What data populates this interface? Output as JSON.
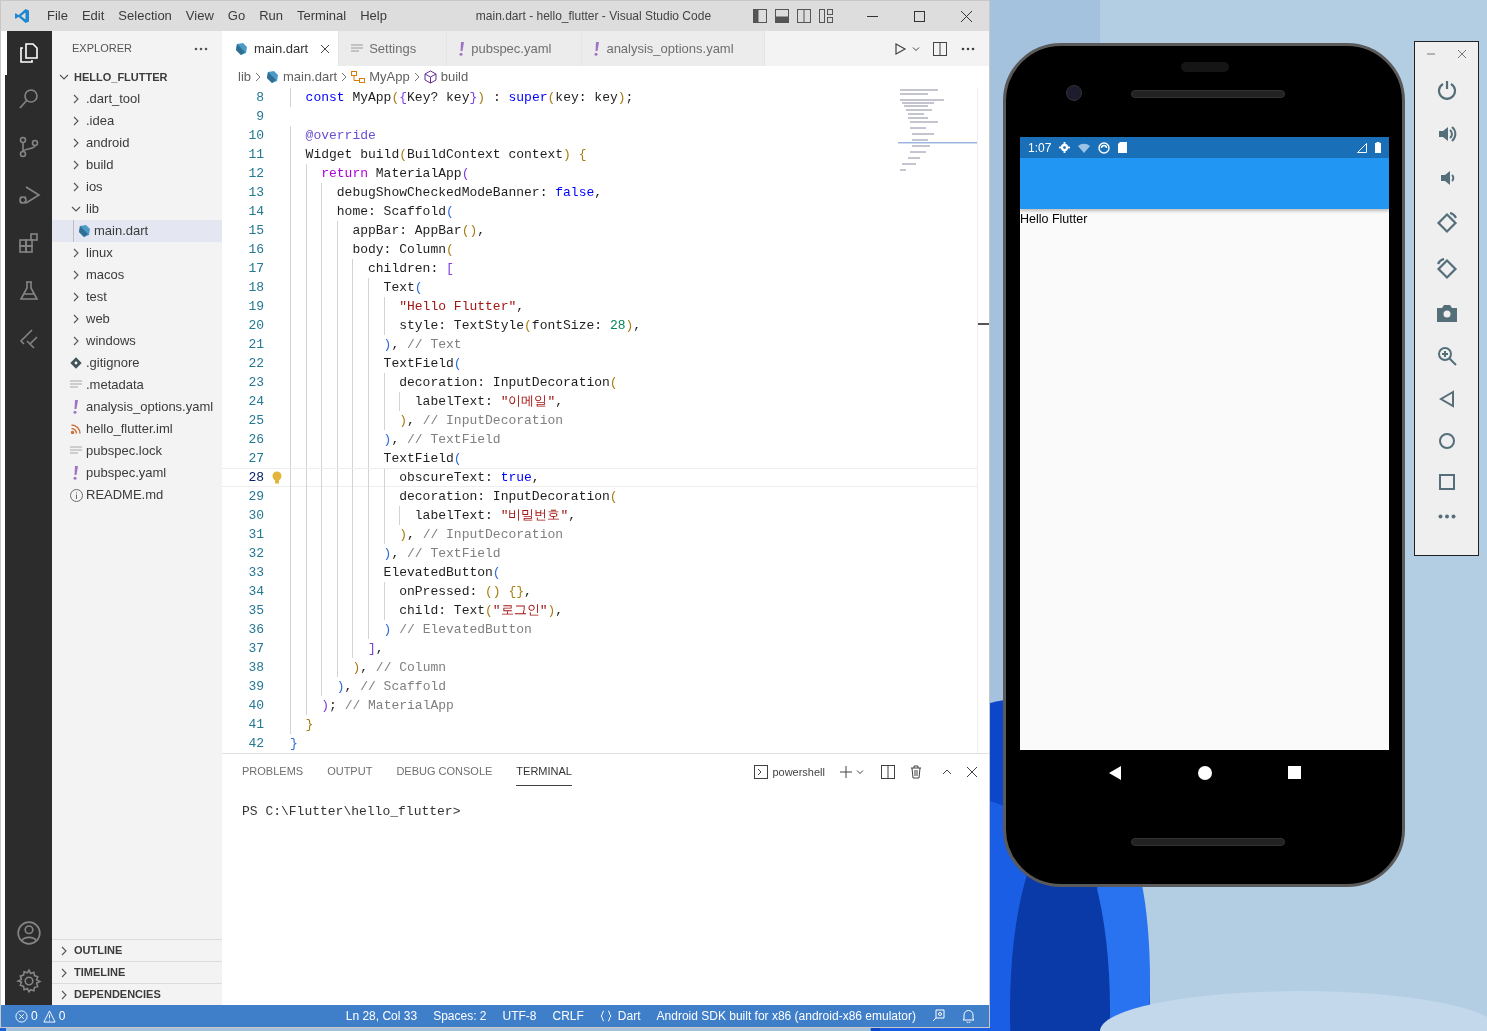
{
  "window": {
    "title": "main.dart - hello_flutter - Visual Studio Code"
  },
  "menu": [
    "File",
    "Edit",
    "Selection",
    "View",
    "Go",
    "Run",
    "Terminal",
    "Help"
  ],
  "sidebar": {
    "title": "EXPLORER",
    "root": {
      "label": "HELLO_FLUTTER",
      "expanded": true
    },
    "items": [
      {
        "label": ".dart_tool",
        "kind": "folder",
        "expanded": false,
        "selected": false
      },
      {
        "label": ".idea",
        "kind": "folder",
        "expanded": false,
        "selected": false
      },
      {
        "label": "android",
        "kind": "folder",
        "expanded": false,
        "selected": false
      },
      {
        "label": "build",
        "kind": "folder",
        "expanded": false,
        "selected": false
      },
      {
        "label": "ios",
        "kind": "folder",
        "expanded": false,
        "selected": false
      },
      {
        "label": "lib",
        "kind": "folder",
        "expanded": true,
        "selected": false,
        "children": [
          {
            "label": "main.dart",
            "kind": "dart",
            "selected": true
          }
        ]
      },
      {
        "label": "linux",
        "kind": "folder",
        "expanded": false,
        "selected": false
      },
      {
        "label": "macos",
        "kind": "folder",
        "expanded": false,
        "selected": false
      },
      {
        "label": "test",
        "kind": "folder",
        "expanded": false,
        "selected": false
      },
      {
        "label": "web",
        "kind": "folder",
        "expanded": false,
        "selected": false
      },
      {
        "label": "windows",
        "kind": "folder",
        "expanded": false,
        "selected": false
      },
      {
        "label": ".gitignore",
        "kind": "git",
        "selected": false
      },
      {
        "label": ".metadata",
        "kind": "text",
        "selected": false
      },
      {
        "label": "analysis_options.yaml",
        "kind": "yaml",
        "selected": false
      },
      {
        "label": "hello_flutter.iml",
        "kind": "feed",
        "selected": false
      },
      {
        "label": "pubspec.lock",
        "kind": "text",
        "selected": false
      },
      {
        "label": "pubspec.yaml",
        "kind": "yaml",
        "selected": false
      },
      {
        "label": "README.md",
        "kind": "info",
        "selected": false
      }
    ],
    "sections": [
      {
        "label": "OUTLINE",
        "expanded": false
      },
      {
        "label": "TIMELINE",
        "expanded": false
      },
      {
        "label": "DEPENDENCIES",
        "expanded": false
      }
    ]
  },
  "tabs": [
    {
      "label": "main.dart",
      "kind": "dart",
      "selected": true
    },
    {
      "label": "Settings",
      "kind": "settings",
      "selected": false
    },
    {
      "label": "pubspec.yaml",
      "kind": "yaml",
      "selected": false
    },
    {
      "label": "analysis_options.yaml",
      "kind": "yaml",
      "selected": false
    }
  ],
  "breadcrumbs": [
    {
      "label": "lib"
    },
    {
      "label": "main.dart",
      "kind": "dart"
    },
    {
      "label": "MyApp",
      "kind": "class"
    },
    {
      "label": "build",
      "kind": "method"
    }
  ],
  "code": [
    {
      "number": "8",
      "current": false,
      "tokens": [
        {
          "kind": "keyword",
          "text": "  const"
        },
        {
          "kind": "plain",
          "text": " MyApp"
        },
        {
          "kind": "bracket1",
          "text": "("
        },
        {
          "kind": "bracket2",
          "text": "{"
        },
        {
          "kind": "plain",
          "text": "Key? key"
        },
        {
          "kind": "bracket2",
          "text": "}"
        },
        {
          "kind": "bracket1",
          "text": ")"
        },
        {
          "kind": "plain",
          "text": " : "
        },
        {
          "kind": "keyword",
          "text": "super"
        },
        {
          "kind": "bracket1",
          "text": "("
        },
        {
          "kind": "plain",
          "text": "key: key"
        },
        {
          "kind": "bracket1",
          "text": ")"
        },
        {
          "kind": "plain",
          "text": ";"
        }
      ]
    },
    {
      "number": "9",
      "current": false
    },
    {
      "number": "10",
      "current": false,
      "tokens": [
        {
          "kind": "meta",
          "text": "  @override"
        }
      ]
    },
    {
      "number": "11",
      "current": false,
      "tokens": [
        {
          "kind": "plain",
          "text": "  Widget build"
        },
        {
          "kind": "bracket1",
          "text": "("
        },
        {
          "kind": "plain",
          "text": "BuildContext context"
        },
        {
          "kind": "bracket1",
          "text": ") {"
        }
      ]
    },
    {
      "number": "12",
      "current": false,
      "tokens": [
        {
          "kind": "control",
          "text": "    return"
        },
        {
          "kind": "plain",
          "text": " MaterialApp"
        },
        {
          "kind": "bracket2",
          "text": "("
        }
      ]
    },
    {
      "number": "13",
      "current": false,
      "tokens": [
        {
          "kind": "plain",
          "text": "      debugShowCheckedModeBanner: "
        },
        {
          "kind": "keyword",
          "text": "false"
        },
        {
          "kind": "plain",
          "text": ","
        }
      ]
    },
    {
      "number": "14",
      "current": false,
      "tokens": [
        {
          "kind": "plain",
          "text": "      home: Scaffold"
        },
        {
          "kind": "bracket3",
          "text": "("
        }
      ]
    },
    {
      "number": "15",
      "current": false,
      "tokens": [
        {
          "kind": "plain",
          "text": "        appBar: AppBar"
        },
        {
          "kind": "bracket1",
          "text": "()"
        },
        {
          "kind": "plain",
          "text": ","
        }
      ]
    },
    {
      "number": "16",
      "current": false,
      "tokens": [
        {
          "kind": "plain",
          "text": "        body: Column"
        },
        {
          "kind": "bracket1",
          "text": "("
        }
      ]
    },
    {
      "number": "17",
      "current": false,
      "tokens": [
        {
          "kind": "plain",
          "text": "          children: "
        },
        {
          "kind": "bracket2",
          "text": "["
        }
      ]
    },
    {
      "number": "18",
      "current": false,
      "tokens": [
        {
          "kind": "plain",
          "text": "            Text"
        },
        {
          "kind": "bracket3",
          "text": "("
        }
      ]
    },
    {
      "number": "19",
      "current": false,
      "tokens": [
        {
          "kind": "string",
          "text": "              \"Hello Flutter\""
        },
        {
          "kind": "plain",
          "text": ","
        }
      ]
    },
    {
      "number": "20",
      "current": false,
      "tokens": [
        {
          "kind": "plain",
          "text": "              style: TextStyle"
        },
        {
          "kind": "bracket1",
          "text": "("
        },
        {
          "kind": "plain",
          "text": "fontSize: "
        },
        {
          "kind": "number",
          "text": "28"
        },
        {
          "kind": "bracket1",
          "text": ")"
        },
        {
          "kind": "plain",
          "text": ","
        }
      ]
    },
    {
      "number": "21",
      "current": false,
      "tokens": [
        {
          "kind": "bracket3",
          "text": "            )"
        },
        {
          "kind": "plain",
          "text": ", "
        },
        {
          "kind": "comment",
          "text": "// Text"
        }
      ]
    },
    {
      "number": "22",
      "current": false,
      "tokens": [
        {
          "kind": "plain",
          "text": "            TextField"
        },
        {
          "kind": "bracket3",
          "text": "("
        }
      ]
    },
    {
      "number": "23",
      "current": false,
      "tokens": [
        {
          "kind": "plain",
          "text": "              decoration: InputDecoration"
        },
        {
          "kind": "bracket1",
          "text": "("
        }
      ]
    },
    {
      "number": "24",
      "current": false,
      "tokens": [
        {
          "kind": "plain",
          "text": "                labelText: "
        },
        {
          "kind": "string",
          "text": "\"이메일\""
        },
        {
          "kind": "plain",
          "text": ","
        }
      ]
    },
    {
      "number": "25",
      "current": false,
      "tokens": [
        {
          "kind": "bracket1",
          "text": "              )"
        },
        {
          "kind": "plain",
          "text": ", "
        },
        {
          "kind": "comment",
          "text": "// InputDecoration"
        }
      ]
    },
    {
      "number": "26",
      "current": false,
      "tokens": [
        {
          "kind": "bracket3",
          "text": "            )"
        },
        {
          "kind": "plain",
          "text": ", "
        },
        {
          "kind": "comment",
          "text": "// TextField"
        }
      ]
    },
    {
      "number": "27",
      "current": false,
      "tokens": [
        {
          "kind": "plain",
          "text": "            TextField"
        },
        {
          "kind": "bracket3",
          "text": "("
        }
      ]
    },
    {
      "number": "28",
      "current": true,
      "tokens": [
        {
          "kind": "plain",
          "text": "              obscureText: "
        },
        {
          "kind": "keyword",
          "text": "true"
        },
        {
          "kind": "plain",
          "text": ","
        }
      ]
    },
    {
      "number": "29",
      "current": false,
      "tokens": [
        {
          "kind": "plain",
          "text": "              decoration: InputDecoration"
        },
        {
          "kind": "bracket1",
          "text": "("
        }
      ]
    },
    {
      "number": "30",
      "current": false,
      "tokens": [
        {
          "kind": "plain",
          "text": "                labelText: "
        },
        {
          "kind": "string",
          "text": "\"비밀번호\""
        },
        {
          "kind": "plain",
          "text": ","
        }
      ]
    },
    {
      "number": "31",
      "current": false,
      "tokens": [
        {
          "kind": "bracket1",
          "text": "              )"
        },
        {
          "kind": "plain",
          "text": ", "
        },
        {
          "kind": "comment",
          "text": "// InputDecoration"
        }
      ]
    },
    {
      "number": "32",
      "current": false,
      "tokens": [
        {
          "kind": "bracket3",
          "text": "            )"
        },
        {
          "kind": "plain",
          "text": ", "
        },
        {
          "kind": "comment",
          "text": "// TextField"
        }
      ]
    },
    {
      "number": "33",
      "current": false,
      "tokens": [
        {
          "kind": "plain",
          "text": "            ElevatedButton"
        },
        {
          "kind": "bracket3",
          "text": "("
        }
      ]
    },
    {
      "number": "34",
      "current": false,
      "tokens": [
        {
          "kind": "plain",
          "text": "              onPressed: "
        },
        {
          "kind": "bracket1",
          "text": "() {}"
        },
        {
          "kind": "plain",
          "text": ","
        }
      ]
    },
    {
      "number": "35",
      "current": false,
      "tokens": [
        {
          "kind": "plain",
          "text": "              child: Text"
        },
        {
          "kind": "bracket1",
          "text": "("
        },
        {
          "kind": "string",
          "text": "\"로그인\""
        },
        {
          "kind": "bracket1",
          "text": ")"
        },
        {
          "kind": "plain",
          "text": ","
        }
      ]
    },
    {
      "number": "36",
      "current": false,
      "tokens": [
        {
          "kind": "bracket3",
          "text": "            )"
        },
        {
          "kind": "comment",
          "text": " // ElevatedButton"
        }
      ]
    },
    {
      "number": "37",
      "current": false,
      "tokens": [
        {
          "kind": "bracket2",
          "text": "          ]"
        },
        {
          "kind": "plain",
          "text": ","
        }
      ]
    },
    {
      "number": "38",
      "current": false,
      "tokens": [
        {
          "kind": "bracket1",
          "text": "        )"
        },
        {
          "kind": "plain",
          "text": ", "
        },
        {
          "kind": "comment",
          "text": "// Column"
        }
      ]
    },
    {
      "number": "39",
      "current": false,
      "tokens": [
        {
          "kind": "bracket3",
          "text": "      )"
        },
        {
          "kind": "plain",
          "text": ", "
        },
        {
          "kind": "comment",
          "text": "// Scaffold"
        }
      ]
    },
    {
      "number": "40",
      "current": false,
      "tokens": [
        {
          "kind": "bracket2",
          "text": "    )"
        },
        {
          "kind": "plain",
          "text": "; "
        },
        {
          "kind": "comment",
          "text": "// MaterialApp"
        }
      ]
    },
    {
      "number": "41",
      "current": false,
      "tokens": [
        {
          "kind": "bracket1",
          "text": "  }"
        }
      ]
    },
    {
      "number": "42",
      "current": false,
      "tokens": [
        {
          "kind": "bracket3",
          "text": "}"
        }
      ]
    }
  ],
  "panel": {
    "tabs": [
      {
        "label": "PROBLEMS",
        "selected": false
      },
      {
        "label": "OUTPUT",
        "selected": false
      },
      {
        "label": "DEBUG CONSOLE",
        "selected": false
      },
      {
        "label": "TERMINAL",
        "selected": true
      }
    ],
    "shell": "powershell",
    "terminal": [
      "PS C:\\Flutter\\hello_flutter>"
    ]
  },
  "status_bar": {
    "errors": "0",
    "warnings": "0",
    "items": [
      "Ln 28, Col 33",
      "Spaces: 2",
      "UTF-8",
      "CRLF"
    ],
    "language": "Dart",
    "device": "Android SDK built for x86 (android-x86 emulator)"
  },
  "emulator": {
    "time": "1:07",
    "content": "Hello Flutter"
  }
}
